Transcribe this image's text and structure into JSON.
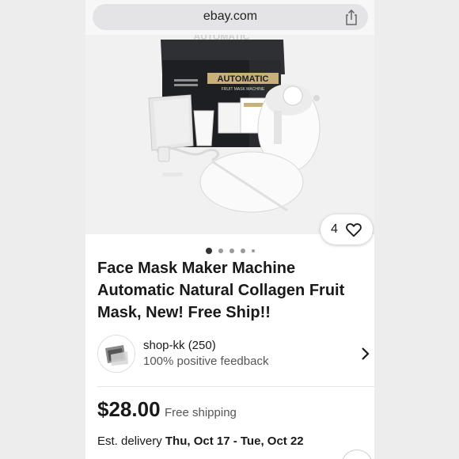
{
  "browser": {
    "url": "ebay.com",
    "share_icon": "share-icon"
  },
  "listing": {
    "like_count": "4",
    "image_count": 5,
    "active_image": 1,
    "box_label": "AUTOMATIC",
    "box_sublabel": "FRUIT MASK MACHINE",
    "title": "Face Mask Maker Machine Automatic Natural Collagen Fruit Mask, New! Free Ship!!"
  },
  "seller": {
    "name": "shop-kk (250)",
    "feedback": "100% positive feedback"
  },
  "pricing": {
    "price": "$28.00",
    "shipping": "Free shipping"
  },
  "delivery": {
    "label": "Est. delivery",
    "dates": "Thu, Oct 17 - Tue, Oct 22"
  }
}
